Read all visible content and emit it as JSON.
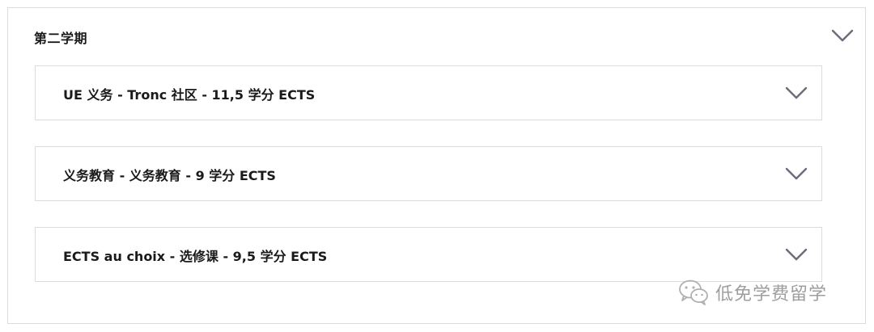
{
  "semester": {
    "title": "第二学期",
    "toggle_icon": "chevron-down-icon"
  },
  "ue_items": [
    {
      "label": "UE 义务 - Tronc 社区 - 11,5 学分 ECTS",
      "icon": "chevron-down-icon"
    },
    {
      "label": "义务教育 - 义务教育 - 9 学分 ECTS",
      "icon": "chevron-down-icon"
    },
    {
      "label": "ECTS au choix - 选修课 - 9,5 学分 ECTS",
      "icon": "chevron-down-icon"
    }
  ],
  "watermark": {
    "text": "低免学费留学",
    "icon": "wechat-icon"
  },
  "colors": {
    "border": "#dcdcdc",
    "chevron": "#6b6b7a",
    "text": "#1a1a1a",
    "watermark": "#9e9e9e"
  }
}
